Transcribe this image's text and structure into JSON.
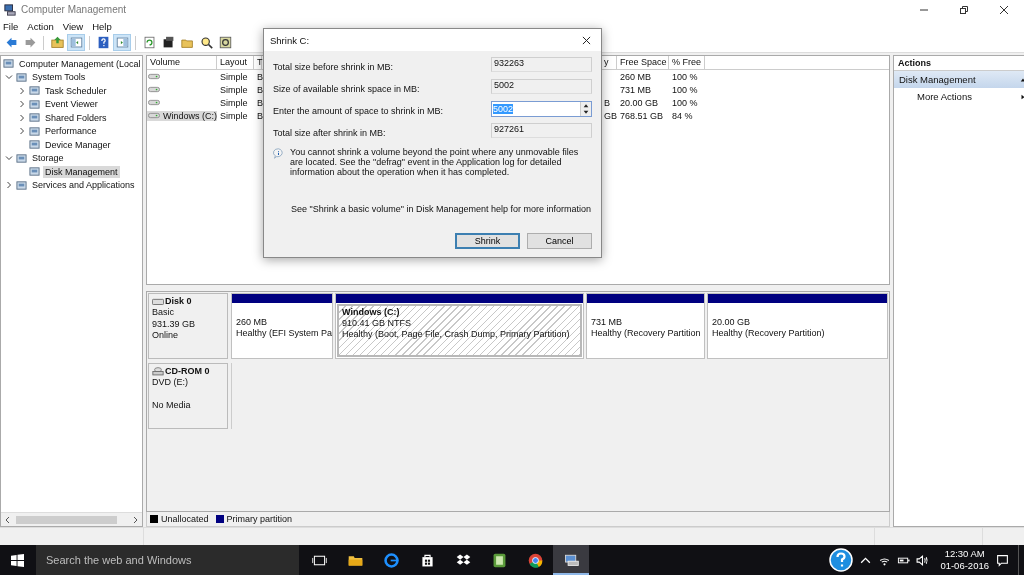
{
  "window": {
    "title": "Computer Management"
  },
  "menu": [
    "File",
    "Action",
    "View",
    "Help"
  ],
  "toolbar": [
    {
      "kind": "back",
      "disabled": false,
      "pressed": false
    },
    {
      "kind": "forward",
      "disabled": true,
      "pressed": false
    },
    {
      "kind": "up",
      "pressed": false
    },
    {
      "kind": "tree",
      "pressed": true
    },
    {
      "kind": "help",
      "pressed": false
    },
    {
      "kind": "pane",
      "pressed": true
    },
    {
      "kind": "refresh",
      "pressed": false
    },
    {
      "kind": "properties",
      "pressed": false
    },
    {
      "kind": "open",
      "pressed": false
    },
    {
      "kind": "search",
      "pressed": false
    },
    {
      "kind": "settings",
      "pressed": false
    }
  ],
  "tree": [
    {
      "label": "Computer Management (Local",
      "selected": false,
      "children": [
        {
          "label": "System Tools",
          "expandable": true,
          "expanded": true,
          "selected": false,
          "children": [
            {
              "label": "Task Scheduler",
              "expandable": true,
              "selected": false
            },
            {
              "label": "Event Viewer",
              "expandable": true,
              "selected": false
            },
            {
              "label": "Shared Folders",
              "expandable": true,
              "selected": false
            },
            {
              "label": "Performance",
              "expandable": true,
              "selected": false
            },
            {
              "label": "Device Manager",
              "selected": false
            }
          ]
        },
        {
          "label": "Storage",
          "expandable": true,
          "expanded": true,
          "selected": false,
          "children": [
            {
              "label": "Disk Management",
              "selected": true
            }
          ]
        },
        {
          "label": "Services and Applications",
          "expandable": true,
          "selected": false
        }
      ]
    }
  ],
  "volumes": {
    "columns": [
      "Volume",
      "Layout",
      "T",
      "y",
      "Free Space",
      "% Free"
    ],
    "rows": [
      {
        "cells": [
          "",
          "Simple",
          "B",
          "",
          "260 MB",
          "100 %"
        ],
        "selected": false
      },
      {
        "cells": [
          "",
          "Simple",
          "B",
          "",
          "731 MB",
          "100 %"
        ],
        "selected": false
      },
      {
        "cells": [
          "",
          "Simple",
          "B",
          "B",
          "20.00 GB",
          "100 %"
        ],
        "selected": false
      },
      {
        "cells": [
          "Windows (C:)",
          "Simple",
          "B",
          "GB",
          "768.51 GB",
          "84 %"
        ],
        "selected": true
      }
    ]
  },
  "disks": [
    {
      "kind": "hdd",
      "name": "Disk 0",
      "type": "Basic",
      "size": "931.39 GB",
      "status": "Online",
      "partitions": [
        {
          "size": "260 MB",
          "status": "Healthy (EFI System Pa",
          "selected": false
        },
        {
          "name": "Windows  (C:)",
          "size": "910.41 GB NTFS",
          "status": "Healthy (Boot, Page File, Crash Dump, Primary Partition)",
          "selected": true
        },
        {
          "size": "731 MB",
          "status": "Healthy (Recovery Partition",
          "selected": false
        },
        {
          "size": "20.00 GB",
          "status": "Healthy (Recovery Partition)",
          "selected": false
        }
      ]
    },
    {
      "kind": "cdrom",
      "name": "CD-ROM 0",
      "type": "DVD (E:)",
      "status": "No Media"
    }
  ],
  "legend": [
    {
      "label": "Unallocated",
      "color": "#000000"
    },
    {
      "label": "Primary partition",
      "color": "#000080"
    }
  ],
  "actions": {
    "title": "Actions",
    "section": {
      "label": "Disk Management",
      "expanded": true
    },
    "items": [
      {
        "label": "More Actions"
      }
    ]
  },
  "dialog": {
    "title": "Shrink C:",
    "fields": [
      {
        "kind": "readonly",
        "label": "Total size before shrink in MB:",
        "value": "932263"
      },
      {
        "kind": "readonly",
        "label": "Size of available shrink space in MB:",
        "value": "5002"
      },
      {
        "kind": "spin",
        "label": "Enter the amount of space to shrink in MB:",
        "value": "5002"
      },
      {
        "kind": "readonly",
        "label": "Total size after shrink in MB:",
        "value": "927261"
      }
    ],
    "info": "You cannot shrink a volume beyond the point where any unmovable files are located. See the \"defrag\" event in the Application log for detailed information about the operation when it has completed.",
    "help": "See \"Shrink a basic volume\" in Disk Management help for more information",
    "buttons": [
      {
        "label": "Shrink",
        "default": true
      },
      {
        "label": "Cancel",
        "default": false
      }
    ]
  },
  "taskbar": {
    "search": {
      "placeholder": "Search the web and Windows"
    },
    "apps": [
      {
        "kind": "taskview",
        "selected": false
      },
      {
        "kind": "explorer",
        "selected": false
      },
      {
        "kind": "edge",
        "selected": false
      },
      {
        "kind": "store",
        "selected": false
      },
      {
        "kind": "dropbox",
        "selected": false
      },
      {
        "kind": "evernote",
        "selected": false
      },
      {
        "kind": "chrome",
        "selected": false
      },
      {
        "kind": "compmgmt",
        "selected": true
      }
    ],
    "clock": {
      "time": "12:30 AM",
      "date": "01-06-2016"
    }
  }
}
